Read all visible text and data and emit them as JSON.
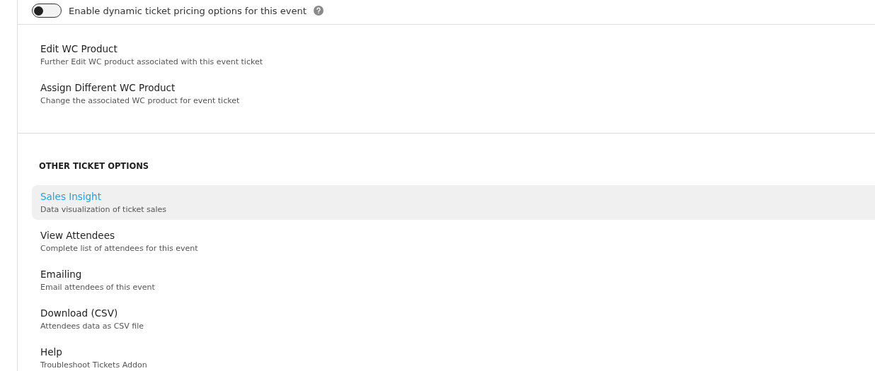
{
  "dynamic_pricing": {
    "label": "Enable dynamic ticket pricing options for this event",
    "on": false
  },
  "product_options": [
    {
      "title": "Edit WC Product",
      "description": "Further Edit WC product associated with this event ticket"
    },
    {
      "title": "Assign Different WC Product",
      "description": "Change the associated WC product for event ticket"
    }
  ],
  "other_ticket_options": {
    "heading": "OTHER TICKET OPTIONS",
    "items": [
      {
        "title": "Sales Insight",
        "description": "Data visualization of ticket sales",
        "selected": true
      },
      {
        "title": "View Attendees",
        "description": "Complete list of attendees for this event",
        "selected": false
      },
      {
        "title": "Emailing",
        "description": "Email attendees of this event",
        "selected": false
      },
      {
        "title": "Download (CSV)",
        "description": "Attendees data as CSV file",
        "selected": false
      },
      {
        "title": "Help",
        "description": "Troubleshoot Tickets Addon",
        "selected": false
      }
    ]
  }
}
